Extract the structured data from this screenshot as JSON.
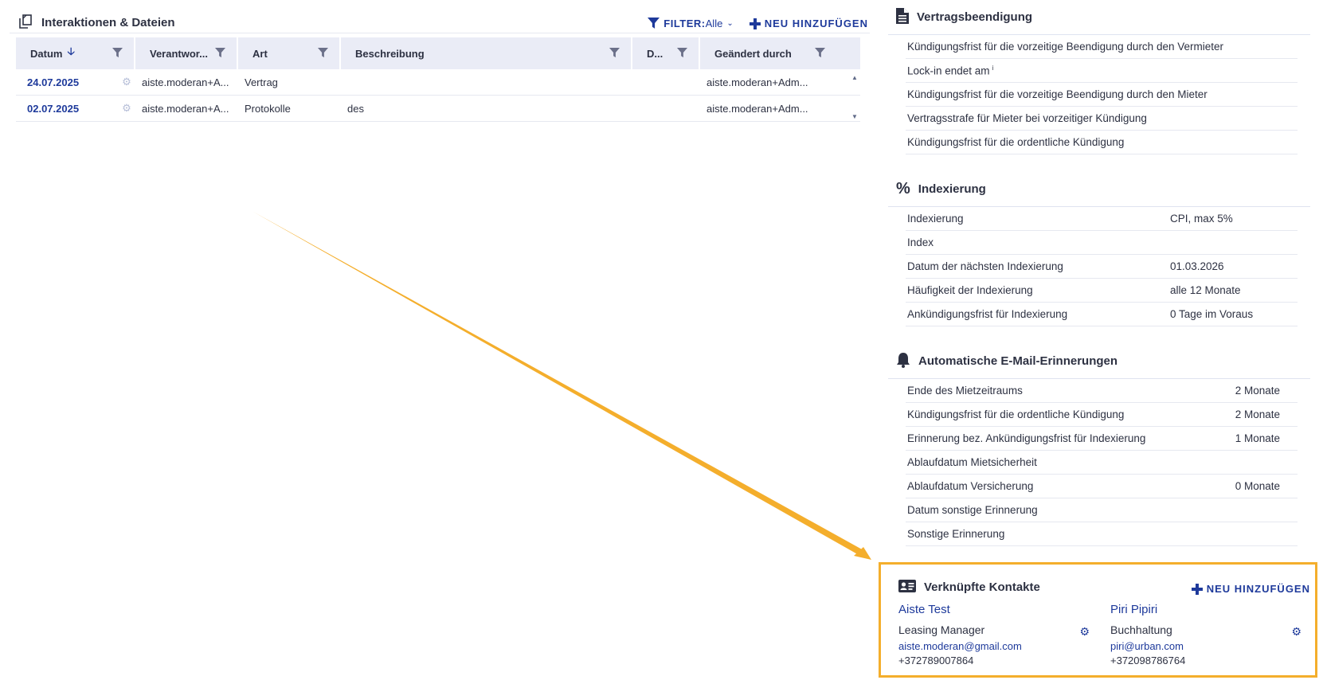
{
  "interactions": {
    "title": "Interaktionen & Dateien",
    "filter_label": "FILTER:",
    "filter_value": "Alle",
    "add_label": "NEU HINZUFÜGEN",
    "columns": [
      "Datum",
      "Verantwor...",
      "Art",
      "Beschreibung",
      "D...",
      "Geändert durch"
    ],
    "rows": [
      {
        "date": "24.07.2025",
        "responsible": "aiste.moderan+A...",
        "type": "Vertrag",
        "description": "",
        "d": "",
        "changed_by": "aiste.moderan+Adm..."
      },
      {
        "date": "02.07.2025",
        "responsible": "aiste.moderan+A...",
        "type": "Protokolle",
        "description": "des",
        "d": "",
        "changed_by": "aiste.moderan+Adm..."
      }
    ]
  },
  "termination": {
    "title": "Vertragsbeendigung",
    "items": [
      "Kündigungsfrist für die vorzeitige Beendigung durch den Vermieter",
      "Lock-in endet am",
      "Kündigungsfrist für die vorzeitige Beendigung durch den Mieter",
      "Vertragsstrafe für Mieter bei vorzeitiger Kündigung",
      "Kündigungsfrist für die ordentliche Kündigung"
    ],
    "info_mark": "i"
  },
  "indexation": {
    "title": "Indexierung",
    "items": [
      {
        "label": "Indexierung",
        "value": "CPI, max 5%"
      },
      {
        "label": "Index",
        "value": ""
      },
      {
        "label": "Datum der nächsten Indexierung",
        "value": "01.03.2026"
      },
      {
        "label": "Häufigkeit der Indexierung",
        "value": "alle 12 Monate"
      },
      {
        "label": "Ankündigungsfrist für Indexierung",
        "value": "0 Tage im Voraus"
      }
    ]
  },
  "reminders": {
    "title": "Automatische E-Mail-Erinnerungen",
    "items": [
      {
        "label": "Ende des Mietzeitraums",
        "value": "2 Monate"
      },
      {
        "label": "Kündigungsfrist für die ordentliche Kündigung",
        "value": "2 Monate"
      },
      {
        "label": "Erinnerung bez. Ankündigungsfrist für Indexierung",
        "value": "1 Monate"
      },
      {
        "label": "Ablaufdatum Mietsicherheit",
        "value": ""
      },
      {
        "label": "Ablaufdatum Versicherung",
        "value": "0 Monate"
      },
      {
        "label": "Datum sonstige Erinnerung",
        "value": ""
      },
      {
        "label": "Sonstige Erinnerung",
        "value": ""
      }
    ]
  },
  "contacts": {
    "title": "Verknüpfte Kontakte",
    "add_label": "NEU HINZUFÜGEN",
    "cards": [
      {
        "name": "Aiste Test",
        "role": "Leasing Manager",
        "email": "aiste.moderan@gmail.com",
        "phone": "+372789007864"
      },
      {
        "name": "Piri Pipiri",
        "role": "Buchhaltung",
        "email": "piri@urban.com",
        "phone": "+372098786764"
      }
    ]
  },
  "colors": {
    "accent": "#1e3a9b",
    "highlight": "#f4ae2c",
    "header_bg": "#eaecf6"
  }
}
